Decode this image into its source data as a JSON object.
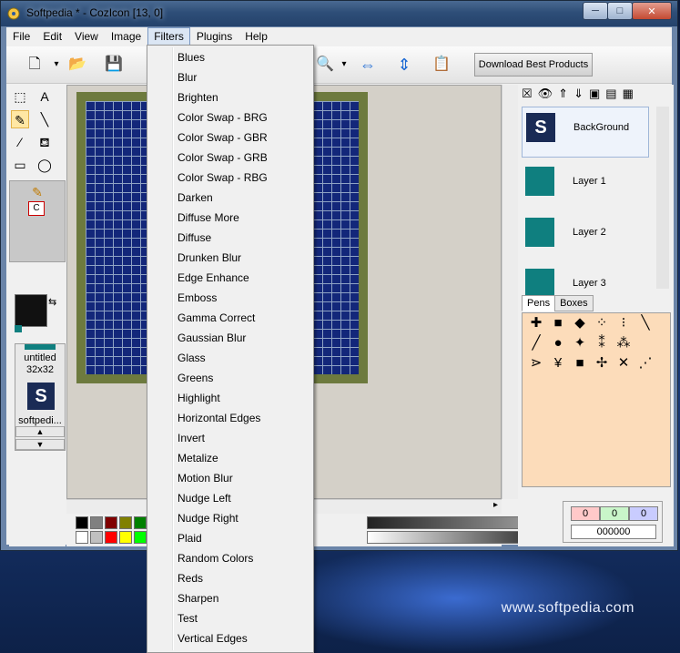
{
  "window": {
    "title": "Softpedia * - CozIcon [13, 0]",
    "min_label": "─",
    "max_label": "□",
    "close_label": "✕"
  },
  "menubar": [
    "File",
    "Edit",
    "View",
    "Image",
    "Filters",
    "Plugins",
    "Help"
  ],
  "toolbar": {
    "download_label": "Download Best Products"
  },
  "filters_menu": {
    "items": [
      "Blues",
      "Blur",
      "Brighten",
      "Color Swap - BRG",
      "Color Swap - GBR",
      "Color Swap - GRB",
      "Color Swap - RBG",
      "Darken",
      "Diffuse More",
      "Diffuse",
      "Drunken Blur",
      "Edge Enhance",
      "Emboss",
      "Gamma Correct",
      "Gaussian Blur",
      "Glass",
      "Greens",
      "Highlight",
      "Horizontal Edges",
      "Invert",
      "Metalize",
      "Motion Blur",
      "Nudge Left",
      "Nudge Right",
      "Plaid",
      "Random Colors",
      "Reds",
      "Sharpen",
      "Test",
      "Vertical Edges"
    ]
  },
  "documents": [
    {
      "label": "untitled",
      "size": "32x32"
    },
    {
      "label": "softpedi..."
    }
  ],
  "layers": [
    "BackGround",
    "Layer 1",
    "Layer 2",
    "Layer 3"
  ],
  "panel_tabs": [
    "Pens",
    "Boxes"
  ],
  "color": {
    "r": "0",
    "g": "0",
    "b": "0",
    "hex": "000000"
  },
  "desktop": {
    "logo": "www.softpedia.com"
  },
  "colors": {
    "grid_fill": "#13277a",
    "grid_border": "#6d7a3e",
    "layer_thumb": "#0f7f7f",
    "pens_bg": "#fcdcba"
  }
}
